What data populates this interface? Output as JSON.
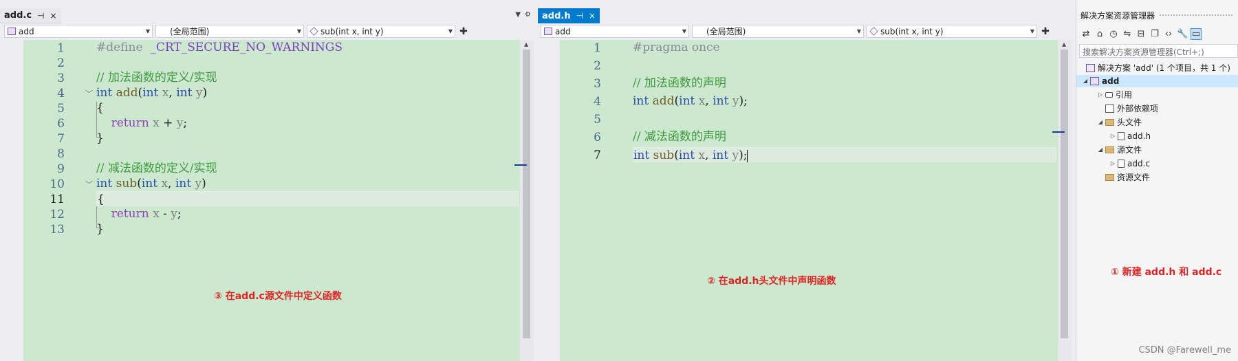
{
  "left_editor": {
    "tab": {
      "label": "add.c",
      "pin": "⊣",
      "close": "×"
    },
    "nav": {
      "project": "add",
      "scope": "(全局范围)",
      "member": "sub(int x, int y)"
    },
    "line_numbers": [
      "1",
      "2",
      "3",
      "4",
      "5",
      "6",
      "7",
      "8",
      "9",
      "10",
      "11",
      "12",
      "13"
    ],
    "current_line": "11",
    "code": {
      "l1_directive": "#define",
      "l1_macro": "_CRT_SECURE_NO_WARNINGS",
      "l3_comment": "// 加法函数的定义/实现",
      "l4_kw1": "int",
      "l4_fn": "add",
      "l4_open": "(",
      "l4_kw2": "int",
      "l4_p1": "x",
      "l4_comma": ",",
      "l4_kw3": "int",
      "l4_p2": "y",
      "l4_close": ")",
      "l5": "{",
      "l6_ret": "return",
      "l6_expr1": "x",
      "l6_op": "+",
      "l6_expr2": "y",
      "l6_semi": ";",
      "l7": "}",
      "l9_comment": "// 减法函数的定义/实现",
      "l10_kw1": "int",
      "l10_fn": "sub",
      "l10_open": "(",
      "l10_kw2": "int",
      "l10_p1": "x",
      "l10_comma": ",",
      "l10_kw3": "int",
      "l10_p2": "y",
      "l10_close": ")",
      "l11": "{",
      "l12_ret": "return",
      "l12_expr1": "x",
      "l12_op": "-",
      "l12_expr2": "y",
      "l12_semi": ";",
      "l13": "}"
    },
    "annotation": "③ 在add.c源文件中定义函数"
  },
  "right_editor": {
    "tab": {
      "label": "add.h",
      "pin": "⊣",
      "close": "×"
    },
    "nav": {
      "project": "add",
      "scope": "(全局范围)",
      "member": "sub(int x, int y)"
    },
    "line_numbers": [
      "1",
      "2",
      "3",
      "4",
      "5",
      "6",
      "7"
    ],
    "current_line": "7",
    "code": {
      "l1": "#pragma once",
      "l3_comment": "// 加法函数的声明",
      "l4_kw1": "int",
      "l4_fn": "add",
      "l4_open": "(",
      "l4_kw2": "int",
      "l4_p1": "x",
      "l4_comma": ",",
      "l4_kw3": "int",
      "l4_p2": "y",
      "l4_close": ");",
      "l6_comment": "// 减法函数的声明",
      "l7_kw1": "int",
      "l7_fn": "sub",
      "l7_open": "(",
      "l7_kw2": "int",
      "l7_p1": "x",
      "l7_comma": ",",
      "l7_kw3": "int",
      "l7_p2": "y",
      "l7_close": ");"
    },
    "annotation": "② 在add.h头文件中声明函数"
  },
  "solution_explorer": {
    "title": "解决方案资源管理器",
    "search_placeholder": "搜索解决方案资源管理器(Ctrl+;)",
    "solution": "解决方案 'add' (1 个项目，共 1 个)",
    "project": "add",
    "references": "引用",
    "external_deps": "外部依赖项",
    "header_folder": "头文件",
    "header_file": "add.h",
    "source_folder": "源文件",
    "source_file": "add.c",
    "resource_folder": "资源文件",
    "annotation": "① 新建 add.h 和 add.c"
  },
  "watermark": "CSDN @Farewell_me",
  "colors": {
    "editor_bg": "#cce8cf",
    "accent": "#007acc",
    "annotation": "#e02424"
  }
}
